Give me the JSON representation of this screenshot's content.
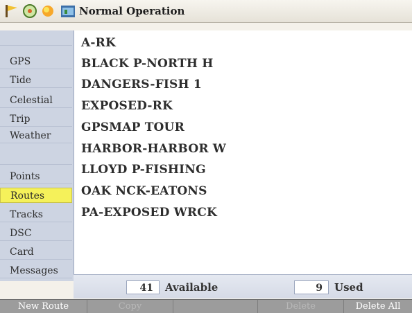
{
  "window": {
    "title": "Normal Operation",
    "icons": [
      "flag-icon",
      "wheel-icon",
      "sun-icon",
      "map-icon"
    ]
  },
  "sidebar": {
    "items": [
      {
        "label": "",
        "icon": "blank-tab",
        "enabled": false
      },
      {
        "label": "GPS",
        "enabled": true
      },
      {
        "label": "Tide",
        "enabled": true
      },
      {
        "label": "Celestial",
        "enabled": true
      },
      {
        "label": "Trip",
        "enabled": true
      },
      {
        "label": "Weather",
        "enabled": true
      },
      {
        "label": "",
        "icon": "blank-tab",
        "enabled": false
      },
      {
        "label": "Points",
        "enabled": true
      },
      {
        "label": "Routes",
        "enabled": true,
        "selected": true
      },
      {
        "label": "Tracks",
        "enabled": true
      },
      {
        "label": "DSC",
        "enabled": true
      },
      {
        "label": "Card",
        "enabled": true
      },
      {
        "label": "Messages",
        "enabled": true
      }
    ]
  },
  "routes": [
    "A-RK",
    "BLACK P-NORTH H",
    "DANGERS-FISH 1",
    "EXPOSED-RK",
    "GPSMAP TOUR",
    "HARBOR-HARBOR W",
    "LLOYD P-FISHING",
    "OAK NCK-EATONS",
    "PA-EXPOSED WRCK"
  ],
  "counts": {
    "available_value": "41",
    "available_label": "Available",
    "used_value": "9",
    "used_label": "Used"
  },
  "softkeys": [
    {
      "label": "New Route",
      "enabled": true
    },
    {
      "label": "Copy",
      "enabled": false
    },
    {
      "label": "",
      "enabled": false
    },
    {
      "label": "Delete",
      "enabled": false
    },
    {
      "label": "Delete All",
      "enabled": true
    }
  ],
  "colors": {
    "selected_tab": "#f5f15a",
    "sidebar_bg": "#cdd4e2",
    "softkey_bg": "#9c9c9c"
  }
}
